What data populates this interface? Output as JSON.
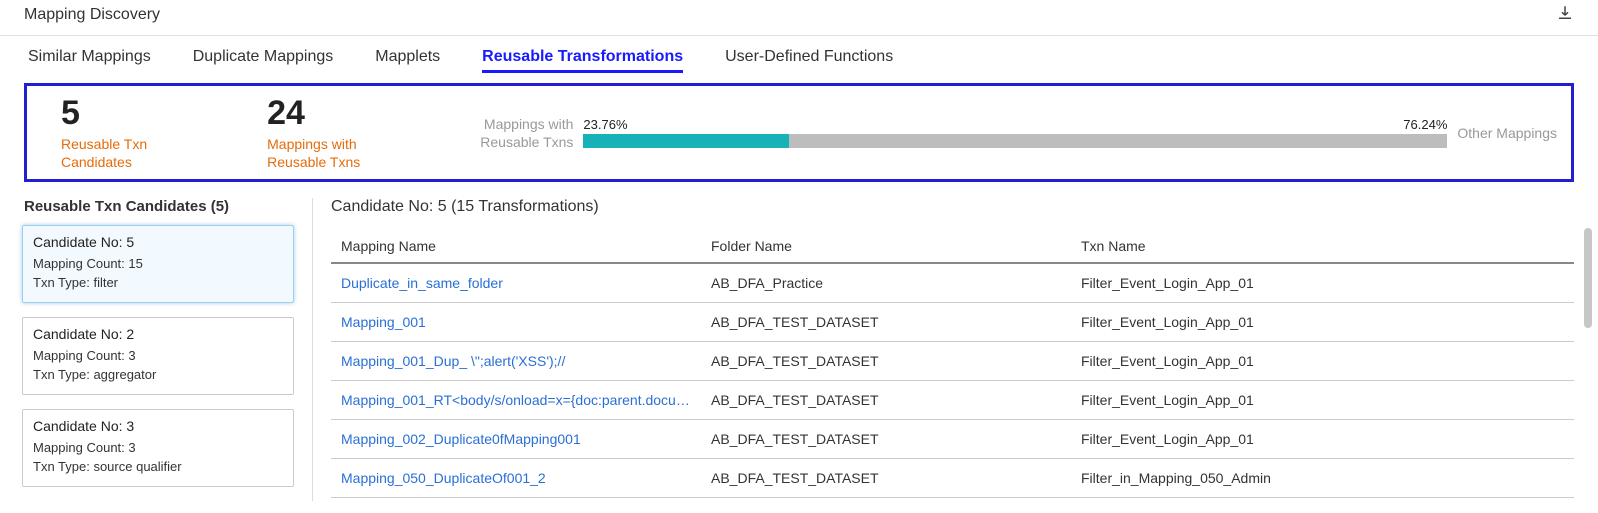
{
  "header": {
    "title": "Mapping Discovery"
  },
  "tabs": {
    "items": [
      {
        "label": "Similar Mappings"
      },
      {
        "label": "Duplicate Mappings"
      },
      {
        "label": "Mapplets"
      },
      {
        "label": "Reusable Transformations"
      },
      {
        "label": "User-Defined Functions"
      }
    ],
    "active_index": 3
  },
  "summary": {
    "stat1": {
      "value": "5",
      "label_line1": "Reusable Txn",
      "label_line2": "Candidates"
    },
    "stat2": {
      "value": "24",
      "label_line1": "Mappings with",
      "label_line2": "Reusable Txns"
    },
    "chart_left_l1": "Mappings with",
    "chart_left_l2": "Reusable Txns",
    "chart_right": "Other Mappings"
  },
  "chart_data": {
    "type": "bar",
    "categories": [
      "Mappings with Reusable Txns",
      "Other Mappings"
    ],
    "values": [
      23.76,
      76.24
    ],
    "value_labels": [
      "23.76%",
      "76.24%"
    ],
    "colors": [
      "#17b1b8",
      "#bdbdbd"
    ]
  },
  "sidebar": {
    "title": "Reusable Txn Candidates (5)",
    "items": [
      {
        "title": "Candidate No: 5",
        "line1": "Mapping Count: 15",
        "line2": "Txn Type: filter"
      },
      {
        "title": "Candidate No: 2",
        "line1": "Mapping Count: 3",
        "line2": "Txn Type: aggregator"
      },
      {
        "title": "Candidate No: 3",
        "line1": "Mapping Count: 3",
        "line2": "Txn Type: source qualifier"
      }
    ],
    "active_index": 0
  },
  "detail": {
    "title": "Candidate No: 5 (15 Transformations)",
    "columns": {
      "c1": "Mapping Name",
      "c2": "Folder Name",
      "c3": "Txn Name"
    },
    "rows": [
      {
        "mapping": "Duplicate_in_same_folder",
        "folder": "AB_DFA_Practice",
        "txn": "Filter_Event_Login_App_01"
      },
      {
        "mapping": "Mapping_001",
        "folder": "AB_DFA_TEST_DATASET",
        "txn": "Filter_Event_Login_App_01"
      },
      {
        "mapping": "Mapping_001_Dup_ \\\";alert('XSS');//",
        "folder": "AB_DFA_TEST_DATASET",
        "txn": "Filter_Event_Login_App_01"
      },
      {
        "mapping": "Mapping_001_RT<body/s/onload=x={doc:parent.docume..",
        "folder": "AB_DFA_TEST_DATASET",
        "txn": "Filter_Event_Login_App_01"
      },
      {
        "mapping": "Mapping_002_Duplicate0fMapping001",
        "folder": "AB_DFA_TEST_DATASET",
        "txn": "Filter_Event_Login_App_01"
      },
      {
        "mapping": "Mapping_050_DuplicateOf001_2",
        "folder": "AB_DFA_TEST_DATASET",
        "txn": "Filter_in_Mapping_050_Admin"
      }
    ]
  }
}
